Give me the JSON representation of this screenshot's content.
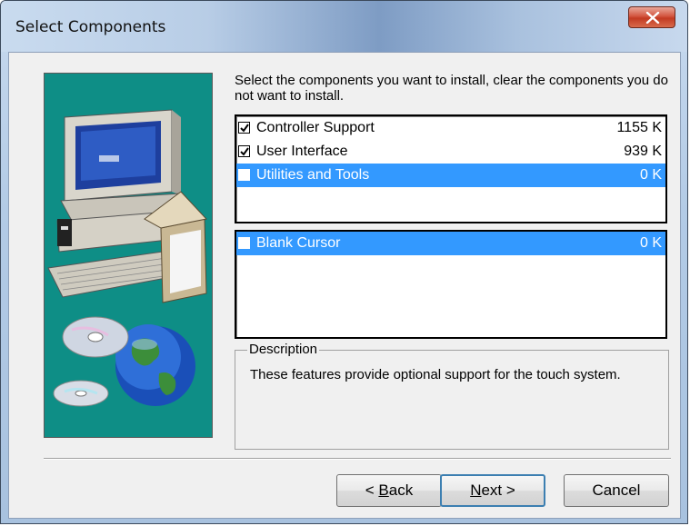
{
  "window": {
    "title": "Select Components"
  },
  "instructions": "Select the components you want to install, clear the components you do not want to install.",
  "components": [
    {
      "name": "Controller Support",
      "size": "1155 K",
      "checked": true,
      "selected": false
    },
    {
      "name": "User Interface",
      "size": "939 K",
      "checked": true,
      "selected": false
    },
    {
      "name": "Utilities and Tools",
      "size": "0 K",
      "checked": false,
      "selected": true
    }
  ],
  "subcomponents": [
    {
      "name": "Blank Cursor",
      "size": "0 K",
      "checked": false,
      "selected": true
    }
  ],
  "description": {
    "label": "Description",
    "text": "These features provide optional support for the touch system."
  },
  "buttons": {
    "back_prefix": "< ",
    "back_accel": "B",
    "back_rest": "ack",
    "next_accel": "N",
    "next_rest": "ext >",
    "cancel": "Cancel"
  },
  "colors": {
    "selection": "#3399ff",
    "art_background": "#0e8e86"
  }
}
